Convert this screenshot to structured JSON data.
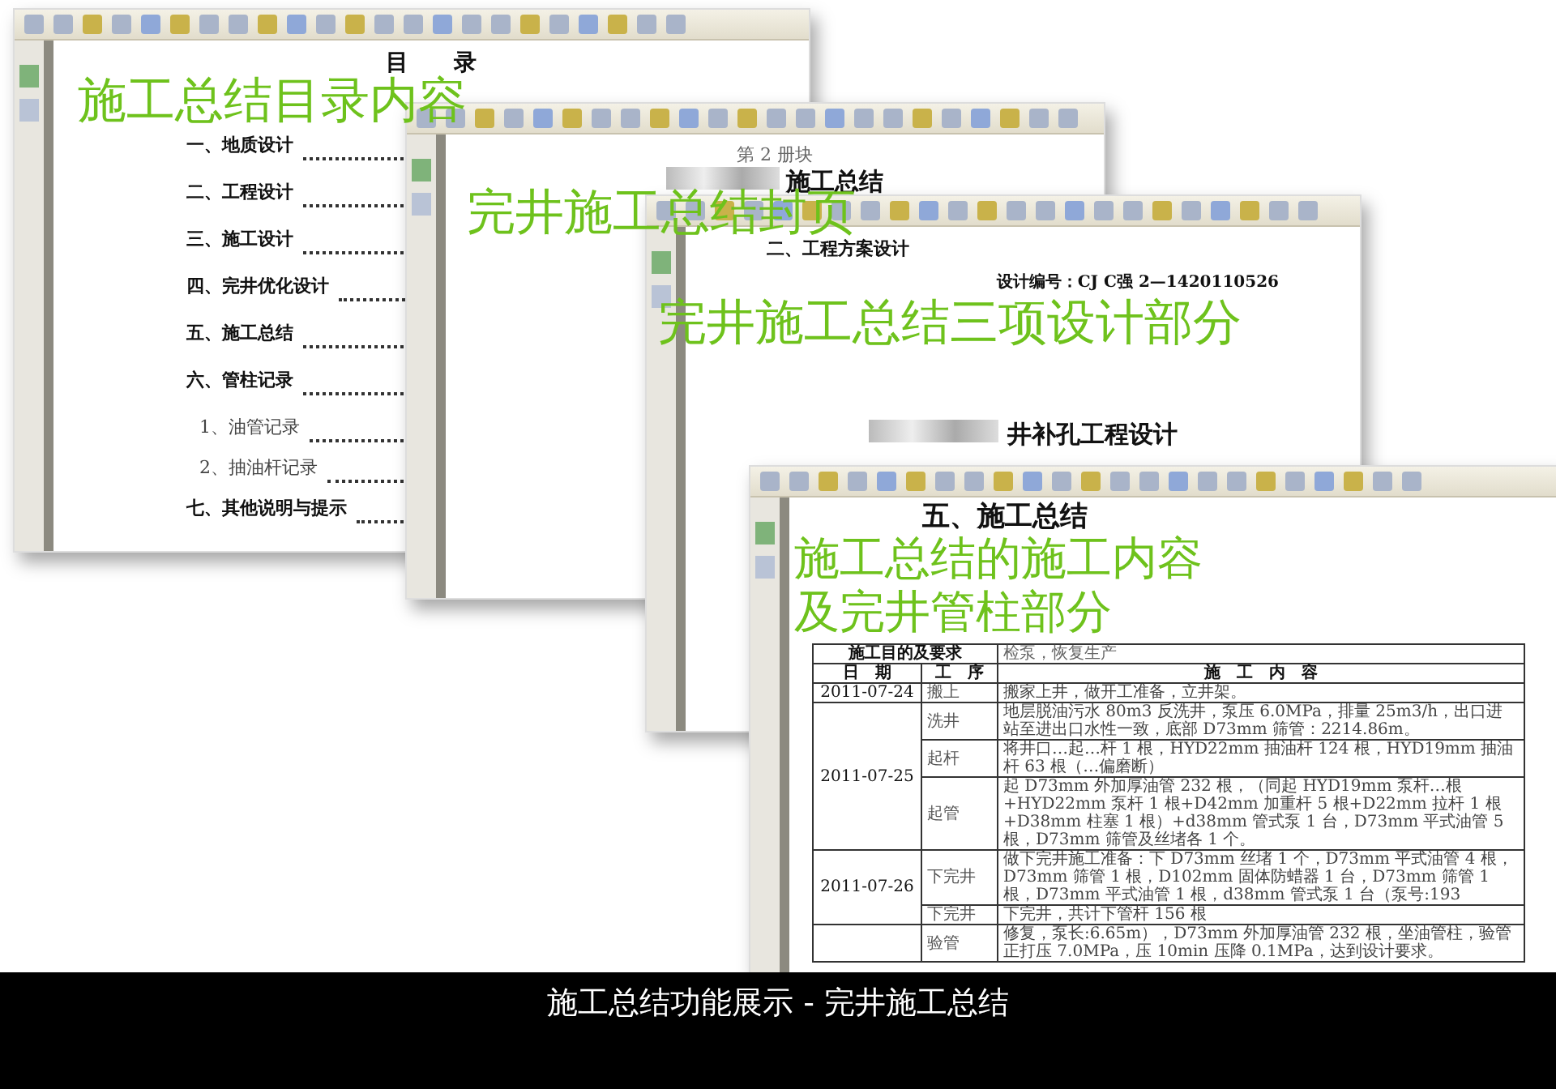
{
  "windows": [
    {
      "kind": "toc",
      "title": "目　　录",
      "items": [
        {
          "text": "一、地质设计"
        },
        {
          "text": "二、工程设计"
        },
        {
          "text": "三、施工设计"
        },
        {
          "text": "四、完井优化设计"
        },
        {
          "text": "五、施工总结"
        },
        {
          "text": "六、管柱记录",
          "children": [
            {
              "text": "1、油管记录"
            },
            {
              "text": "2、抽油杆记录"
            }
          ]
        },
        {
          "text": "七、其他说明与提示"
        }
      ]
    },
    {
      "kind": "cover",
      "subtitle": "第 2 册块",
      "heading": "施工总结"
    },
    {
      "kind": "design",
      "section": "二、工程方案设计",
      "code": "设计编号：CJ C强 2—1420110526",
      "heading": "井补孔工程设计"
    },
    {
      "kind": "summary",
      "heading": "五、施工总结",
      "purpose_label": "施工目的及要求",
      "purpose": "检泵，恢复生产",
      "columns": [
        "日　期",
        "工　序",
        "施　工　内　容"
      ],
      "days": [
        {
          "date": "2011-07-24",
          "steps": [
            {
              "step": "搬上",
              "content": "搬家上井，做开工准备，立井架。"
            }
          ]
        },
        {
          "date": "2011-07-25",
          "steps": [
            {
              "step": "洗井",
              "content": "地层脱油污水 80m3 反洗井，泵压 6.0MPa，排量 25m3/h，出口进站至进出口水性一致，底部 D73mm 筛管：2214.86m。"
            },
            {
              "step": "起杆",
              "content": "将井口…起…杆 1 根，HYD22mm 抽油杆 124 根，HYD19mm 抽油杆 63 根（…偏磨断）"
            },
            {
              "step": "起管",
              "content": "起 D73mm 外加厚油管 232 根，（同起 HYD19mm 泵杆…根+HYD22mm 泵杆 1 根+D42mm 加重杆 5 根+D22mm 拉杆 1 根+D38mm 柱塞 1 根）+d38mm 管式泵 1 台，D73mm 平式油管 5 根，D73mm 筛管及丝堵各 1 个。"
            }
          ]
        },
        {
          "date": "2011-07-26",
          "steps": [
            {
              "step": "下完井",
              "content": "做下完井施工准备：下 D73mm 丝堵 1 个，D73mm 平式油管 4 根，D73mm 筛管 1 根，D102mm 固体防蜡器 1 台，D73mm 筛管 1 根，D73mm 平式油管 1 根，d38mm 管式泵 1 台（泵号:193"
            },
            {
              "step": "下完井",
              "content": "下完井，共计下管杆 156 根"
            }
          ]
        },
        {
          "steps": [
            {
              "step": "验管",
              "content": "修复，泵长:6.65m），D73mm 外加厚油管 232 根，坐油管柱，验管正打压 7.0MPa，压 10min 压降 0.1MPa，达到设计要求。"
            }
          ]
        }
      ]
    }
  ],
  "captions": [
    {
      "lines": [
        "施工总结目录内容"
      ]
    },
    {
      "lines": [
        "完井施工总结封页"
      ]
    },
    {
      "lines": [
        "完井施工总结三项设计部分"
      ]
    },
    {
      "lines": [
        "施工总结的施工内容",
        "及完井管柱部分"
      ]
    }
  ],
  "footer": "施工总结功能展示 - 完井施工总结"
}
